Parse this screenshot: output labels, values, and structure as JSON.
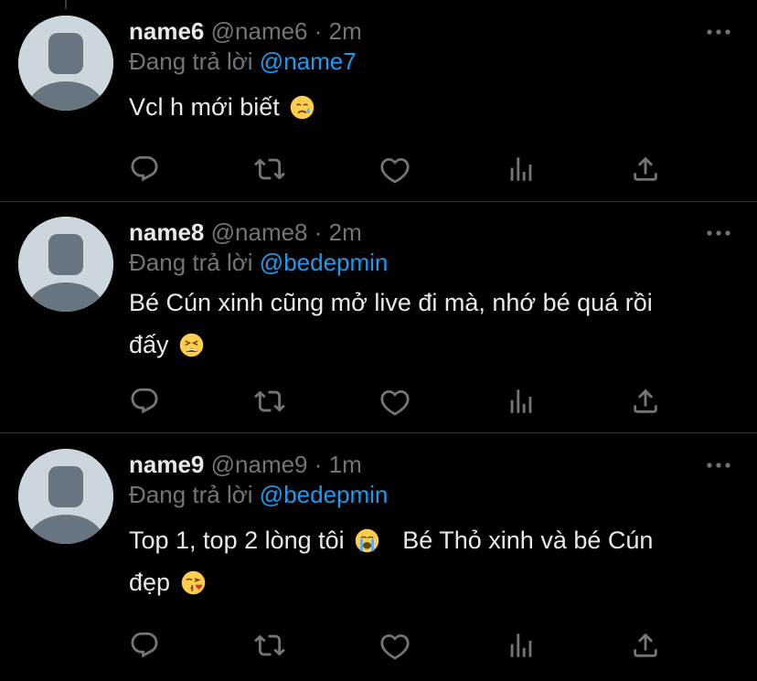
{
  "tweets": [
    {
      "name": "name6",
      "handle": "@name6",
      "dot": "·",
      "time": "2m",
      "reply_prefix": "Đang trả lời",
      "reply_to": "@name7",
      "text_lines": [
        "Vcl h mới biết"
      ],
      "emoji_icons": [
        "crying-face-emoji"
      ]
    },
    {
      "name": "name8",
      "handle": "@name8",
      "dot": "·",
      "time": "2m",
      "reply_prefix": "Đang trả lời",
      "reply_to": "@bedepmin",
      "text_lines": [
        "Bé Cún xinh cũng mở live đi mà, nhớ bé quá rồi",
        "đấy"
      ],
      "emoji_icons": [
        "tired-face-emoji"
      ]
    },
    {
      "name": "name9",
      "handle": "@name9",
      "dot": "·",
      "time": "1m",
      "reply_prefix": "Đang trả lời",
      "reply_to": "@bedepmin",
      "text_lines": [
        "Top 1, top 2 lòng tôi",
        "Bé Thỏ xinh và bé Cún",
        "đẹp"
      ],
      "emoji_icons": [
        "loudly-crying-face-emoji",
        "kissing-heart-face-emoji"
      ]
    }
  ],
  "colors": {
    "background": "#000000",
    "primary_text": "#e7e9ea",
    "secondary_text": "#71767b",
    "accent": "#1d9bf0",
    "divider": "#2f3336"
  },
  "action_icons": [
    "reply-icon",
    "retweet-icon",
    "like-icon",
    "analytics-icon",
    "share-icon"
  ]
}
